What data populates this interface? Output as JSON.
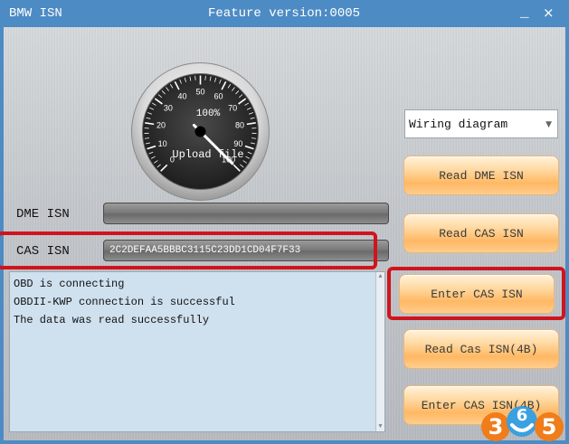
{
  "window": {
    "app_title": "BMW ISN",
    "feature_version": "Feature version:0005",
    "minimize_symbol": "_",
    "close_symbol": "×"
  },
  "gauge": {
    "percent_label": "100%",
    "caption": "Upload file",
    "ticks": [
      "0",
      "10",
      "20",
      "30",
      "40",
      "50",
      "60",
      "70",
      "80",
      "90",
      "100"
    ],
    "value_percent": 100
  },
  "fields": {
    "dme_label": "DME ISN",
    "dme_value": "",
    "cas_label": "CAS ISN",
    "cas_value": "2C2DEFAA5BBBC3115C23DD1CD04F7F33"
  },
  "log": {
    "lines": [
      "OBD is connecting",
      "OBDII-KWP connection is successful",
      "The data was read successfully"
    ]
  },
  "dropdown": {
    "selected": "Wiring diagram"
  },
  "buttons": {
    "read_dme": "Read DME ISN",
    "read_cas": "Read CAS ISN",
    "enter_cas": "Enter CAS ISN",
    "read_cas_4b": "Read Cas ISN(4B)",
    "enter_cas_4b": "Enter CAS ISN(4B)"
  },
  "watermark": {
    "text_3": "3",
    "text_6": "6",
    "text_5": "5"
  },
  "colors": {
    "titlebar": "#4d8bc4",
    "highlight": "#d0141e",
    "button_orange": "#ffb864",
    "log_bg": "#cfe0ee",
    "watermark_orange": "#f07c1a",
    "watermark_blue": "#3aa0e0"
  }
}
